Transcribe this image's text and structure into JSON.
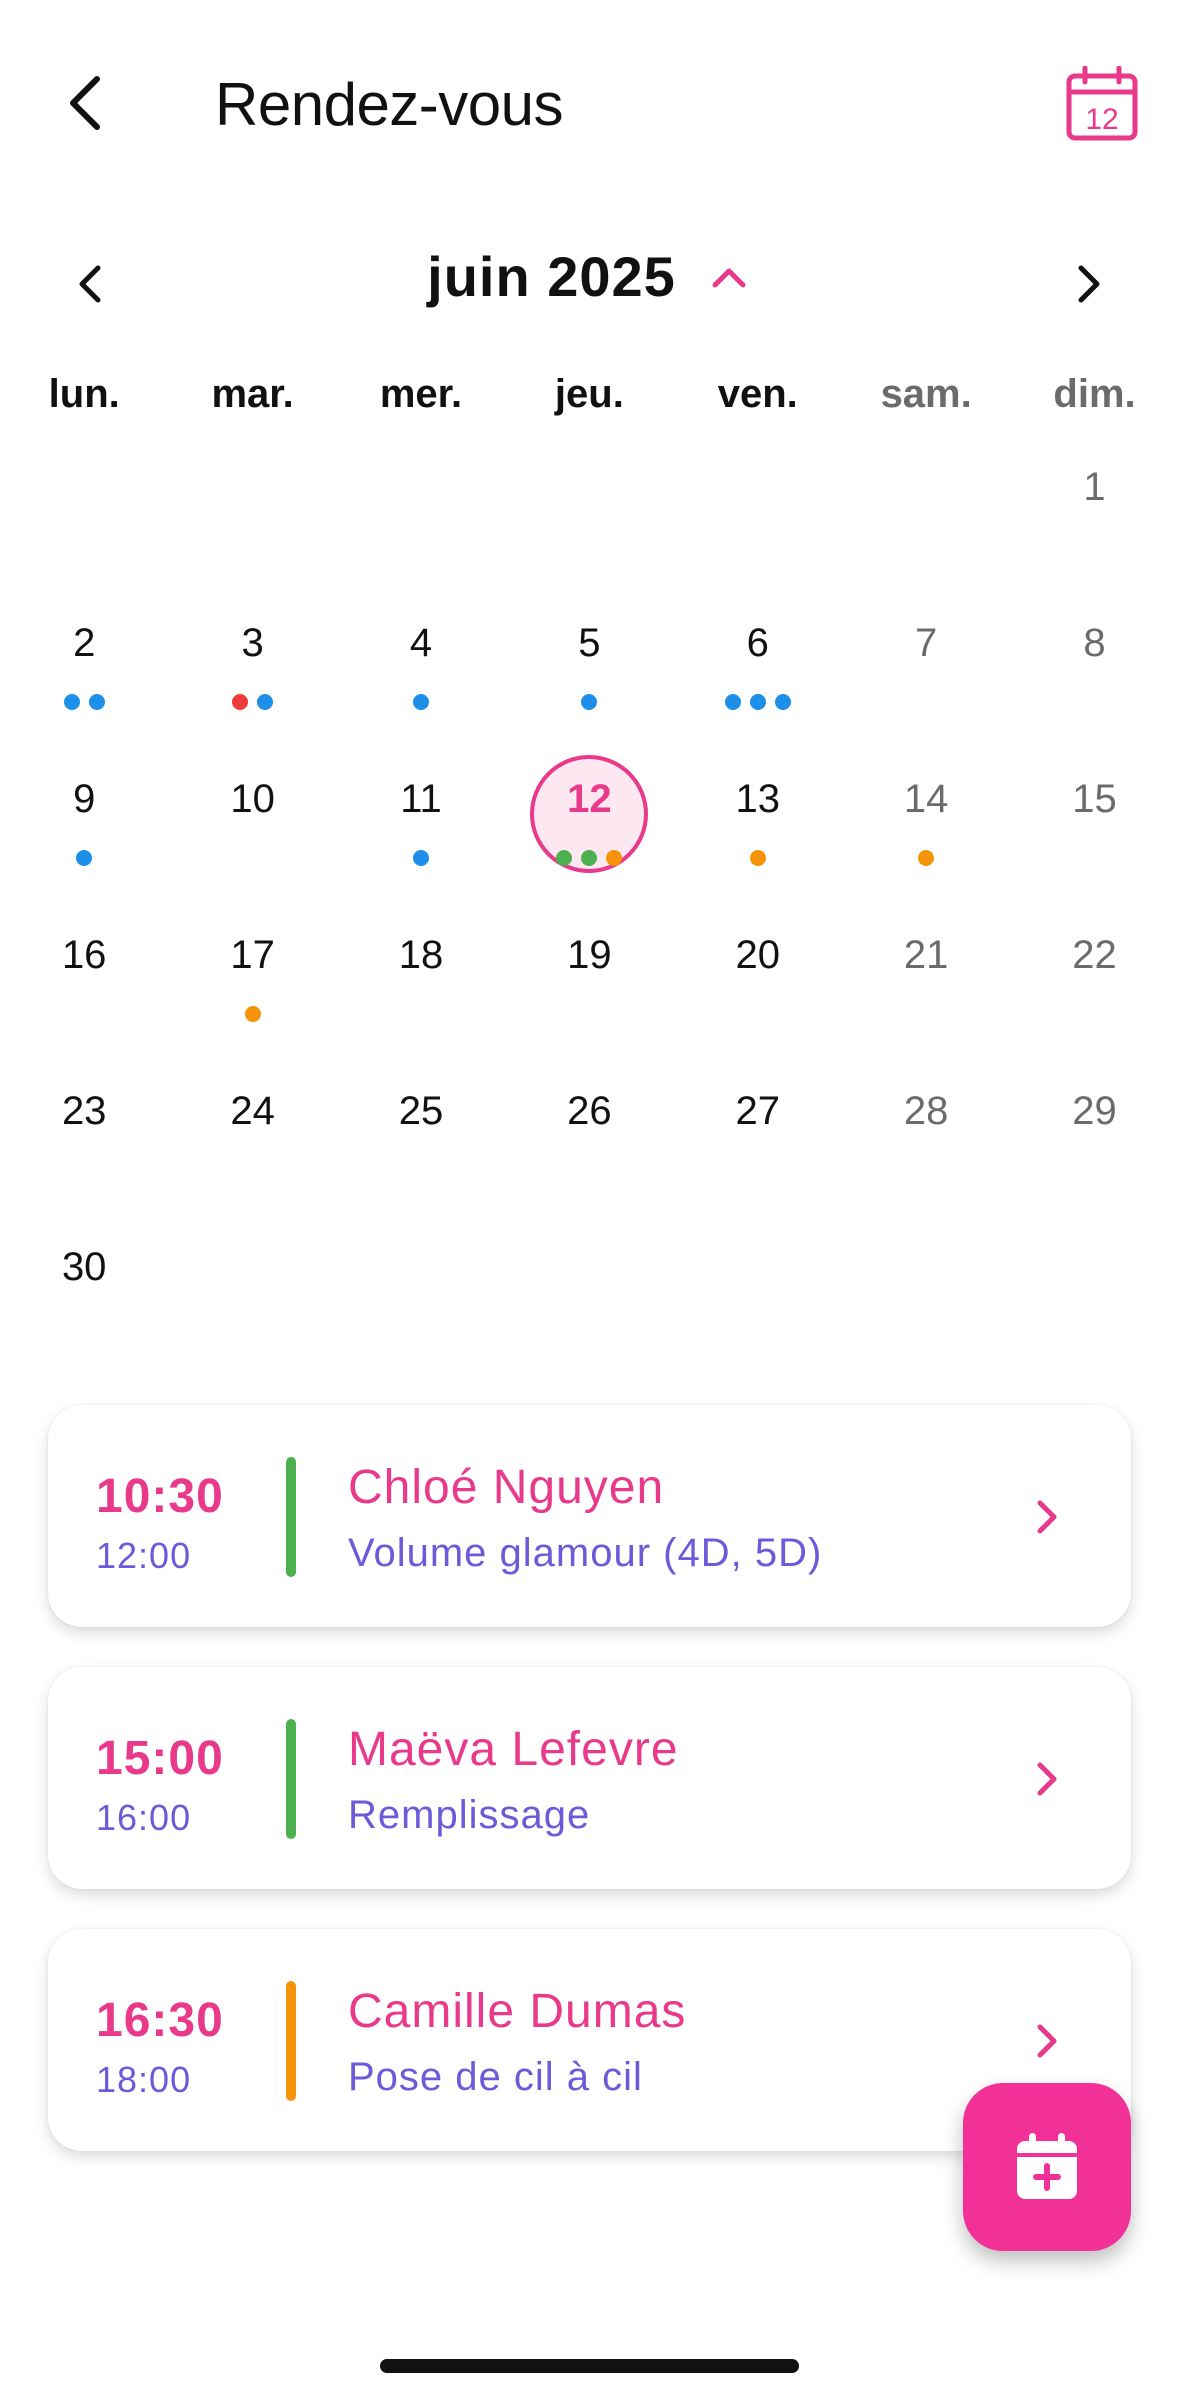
{
  "header": {
    "title": "Rendez-vous",
    "back_icon": "chevron-left-icon",
    "calendar_icon": "calendar-icon",
    "calendar_icon_day": "12"
  },
  "month": {
    "label": "juin 2025",
    "prev_icon": "chevron-left-icon",
    "next_icon": "chevron-right-icon",
    "toggle_icon": "chevron-up-icon"
  },
  "weekdays": [
    "lun.",
    "mar.",
    "mer.",
    "jeu.",
    "ven.",
    "sam.",
    "dim."
  ],
  "calendar": {
    "leading_blanks": 6,
    "selected_day": 12,
    "days": [
      {
        "day": "1",
        "dots": []
      },
      {
        "day": "2",
        "dots": [
          "#1e8fe8",
          "#1e8fe8"
        ]
      },
      {
        "day": "3",
        "dots": [
          "#ee3b3b",
          "#1e8fe8"
        ]
      },
      {
        "day": "4",
        "dots": [
          "#1e8fe8"
        ]
      },
      {
        "day": "5",
        "dots": [
          "#1e8fe8"
        ]
      },
      {
        "day": "6",
        "dots": [
          "#1e8fe8",
          "#1e8fe8",
          "#1e8fe8"
        ]
      },
      {
        "day": "7",
        "dots": []
      },
      {
        "day": "8",
        "dots": []
      },
      {
        "day": "9",
        "dots": [
          "#1e8fe8"
        ]
      },
      {
        "day": "10",
        "dots": []
      },
      {
        "day": "11",
        "dots": [
          "#1e8fe8"
        ]
      },
      {
        "day": "12",
        "dots": [
          "#4caf50",
          "#4caf50",
          "#f5930b"
        ]
      },
      {
        "day": "13",
        "dots": [
          "#f5930b"
        ]
      },
      {
        "day": "14",
        "dots": [
          "#f5930b"
        ]
      },
      {
        "day": "15",
        "dots": []
      },
      {
        "day": "16",
        "dots": []
      },
      {
        "day": "17",
        "dots": [
          "#f5930b"
        ]
      },
      {
        "day": "18",
        "dots": []
      },
      {
        "day": "19",
        "dots": []
      },
      {
        "day": "20",
        "dots": []
      },
      {
        "day": "21",
        "dots": []
      },
      {
        "day": "22",
        "dots": []
      },
      {
        "day": "23",
        "dots": []
      },
      {
        "day": "24",
        "dots": []
      },
      {
        "day": "25",
        "dots": []
      },
      {
        "day": "26",
        "dots": []
      },
      {
        "day": "27",
        "dots": []
      },
      {
        "day": "28",
        "dots": []
      },
      {
        "day": "29",
        "dots": []
      },
      {
        "day": "30",
        "dots": []
      }
    ]
  },
  "appointments": [
    {
      "start": "10:30",
      "end": "12:00",
      "name": "Chloé Nguyen",
      "service": "Volume glamour (4D, 5D)",
      "status_color": "#4caf50"
    },
    {
      "start": "15:00",
      "end": "16:00",
      "name": "Maëva Lefevre",
      "service": "Remplissage",
      "status_color": "#4caf50"
    },
    {
      "start": "16:30",
      "end": "18:00",
      "name": "Camille Dumas",
      "service": "Pose de cil à cil",
      "status_color": "#f5930b"
    }
  ],
  "fab": {
    "icon": "calendar-add-icon"
  },
  "colors": {
    "accent": "#e8398b",
    "fab": "#f13198",
    "secondary_text": "#6b5bd9"
  }
}
